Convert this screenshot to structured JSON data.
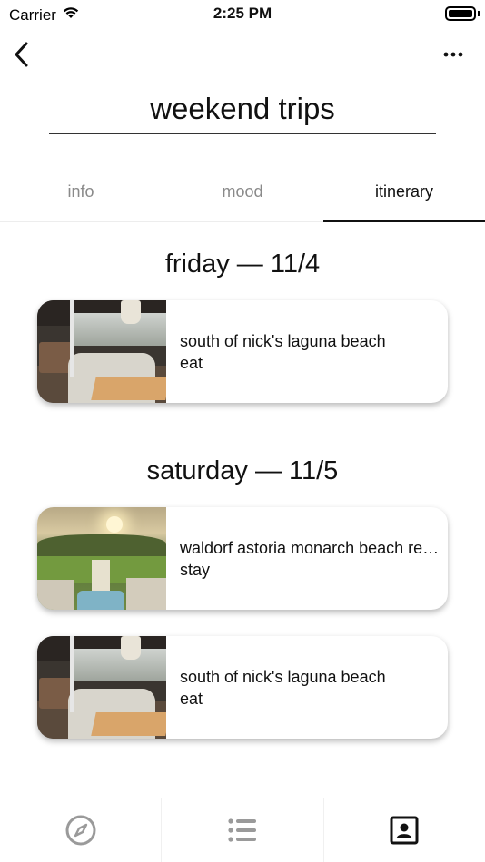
{
  "status_bar": {
    "carrier": "Carrier",
    "time": "2:25 PM"
  },
  "title": "weekend trips",
  "tabs": [
    {
      "label": "info",
      "active": false
    },
    {
      "label": "mood",
      "active": false
    },
    {
      "label": "itinerary",
      "active": true
    }
  ],
  "days": [
    {
      "header": "friday  —  11/4",
      "items": [
        {
          "title": "south of nick's laguna beach",
          "category": "eat",
          "thumbnail": "restaurant-interior"
        }
      ]
    },
    {
      "header": "saturday  —  11/5",
      "items": [
        {
          "title": "waldorf astoria monarch beach resort",
          "category": "stay",
          "thumbnail": "hotel-resort"
        },
        {
          "title": "south of nick's laguna beach",
          "category": "eat",
          "thumbnail": "restaurant-interior"
        }
      ]
    }
  ],
  "tabbar": [
    {
      "icon": "compass-icon",
      "active": false
    },
    {
      "icon": "list-icon",
      "active": false
    },
    {
      "icon": "profile-card-icon",
      "active": true
    }
  ],
  "colors": {
    "active": "#111111",
    "inactive": "#8a8a8a"
  }
}
